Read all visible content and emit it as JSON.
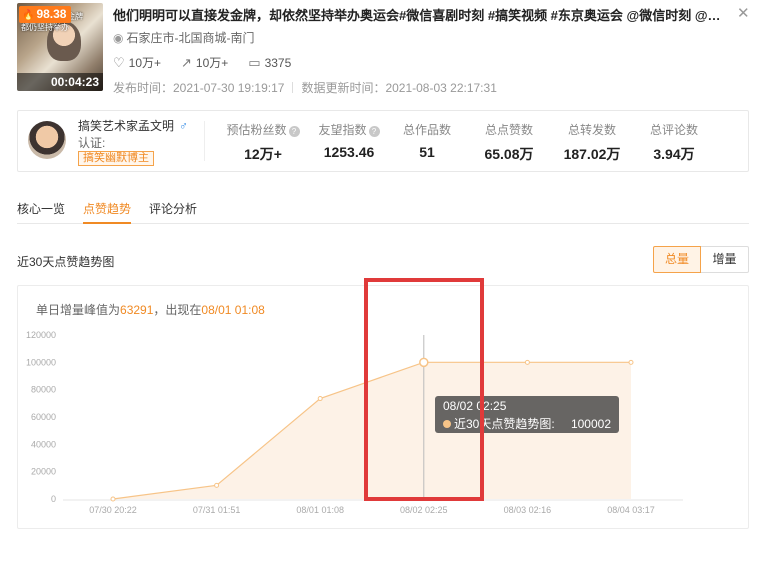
{
  "video": {
    "score": "98.38",
    "duration": "00:04:23",
    "thumb_caption": "金牌",
    "thumb_sub": "都仍坚持举办",
    "title": "他们明明可以直接发金牌，却依然坚持举办奥运会#微信喜剧时刻 #搞笑视频 #东京奥运会 @微信时刻 @微信创...",
    "location": "石家庄市-北国商城-南门",
    "likes": "10万+",
    "shares": "10万+",
    "comments": "3375",
    "publish_time": "发布时间：2021-07-30 19:19:17",
    "update_time": "数据更新时间：2021-08-03 22:17:31",
    "icons": {
      "score": "flame-icon",
      "location": "location-pin-icon",
      "likes": "heart-icon",
      "shares": "share-icon",
      "comments": "comment-icon",
      "close": "close-icon"
    }
  },
  "author": {
    "name": "搞笑艺术家孟文明",
    "gender_symbol": "♂",
    "cert_label": "认证:",
    "tag": "搞笑幽默博主",
    "metrics": [
      {
        "label": "预估粉丝数",
        "value": "12万+",
        "help": true
      },
      {
        "label": "友望指数",
        "value": "1253.46",
        "help": true
      },
      {
        "label": "总作品数",
        "value": "51",
        "help": false
      },
      {
        "label": "总点赞数",
        "value": "65.08万",
        "help": false
      },
      {
        "label": "总转发数",
        "value": "187.02万",
        "help": false
      },
      {
        "label": "总评论数",
        "value": "3.94万",
        "help": false
      }
    ]
  },
  "tabs": [
    {
      "label": "核心一览",
      "active": false
    },
    {
      "label": "点赞趋势",
      "active": true
    },
    {
      "label": "评论分析",
      "active": false
    }
  ],
  "chart_section": {
    "title": "近30天点赞趋势图",
    "toggle_total": "总量",
    "toggle_increment": "增量",
    "peak_prefix": "单日增量峰值为",
    "peak_value": "63291",
    "peak_mid": "，出现在",
    "peak_date": "08/01 01:08"
  },
  "tooltip": {
    "title": "08/02 02:25",
    "series": "近30天点赞趋势图:",
    "value": "100002"
  },
  "colors": {
    "accent": "#f08a24",
    "line": "#f7c488",
    "area": "#fdf0e3",
    "annotation": "#e03a3a"
  },
  "chart_data": {
    "type": "area",
    "x": [
      "07/30 20:22",
      "07/31 01:51",
      "08/01 01:08",
      "08/02 02:25",
      "08/03 02:16",
      "08/04 03:17"
    ],
    "series": [
      {
        "name": "近30天点赞趋势图",
        "values": [
          0,
          10000,
          73500,
          100002,
          100002,
          100002
        ]
      }
    ],
    "y_ticks": [
      0,
      20000,
      40000,
      60000,
      80000,
      100000,
      120000
    ],
    "ylim": [
      0,
      120000
    ],
    "highlight_index": 3,
    "grid": false
  }
}
